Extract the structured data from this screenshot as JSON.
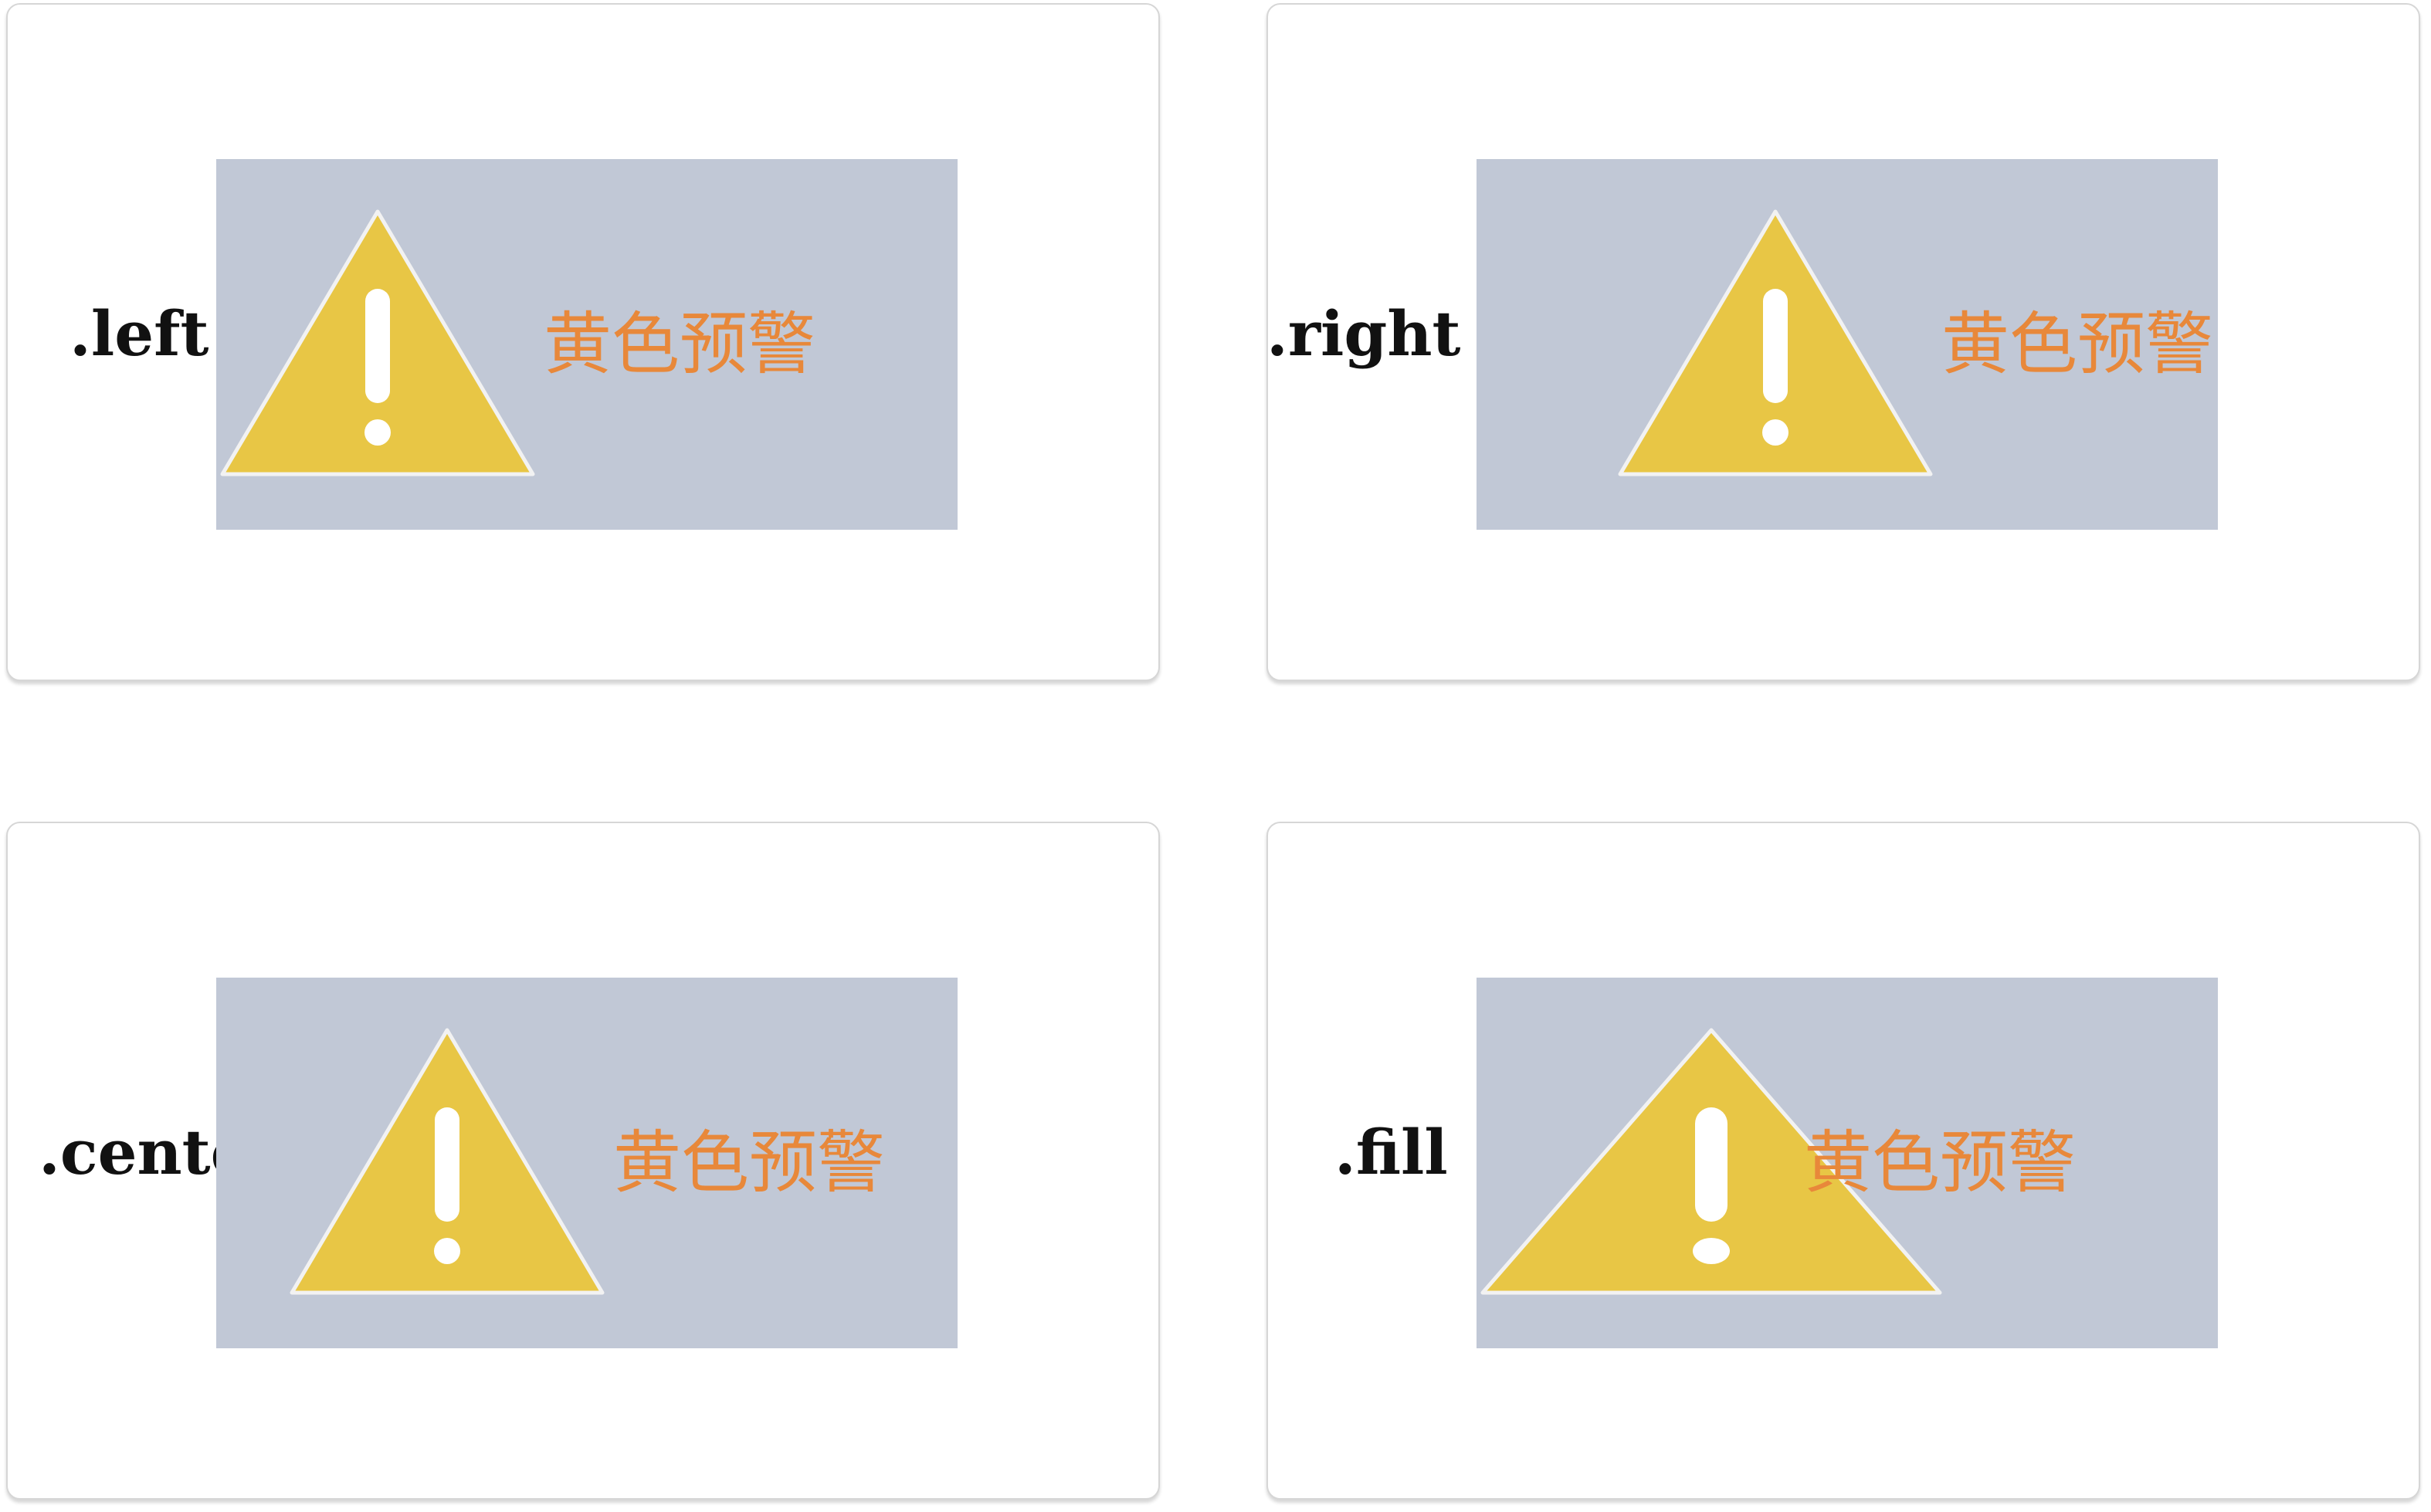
{
  "cards": [
    {
      "id": "left",
      "label": ".left",
      "warning_text": "黄色预警"
    },
    {
      "id": "right",
      "label": ".right",
      "warning_text": "黄色预警"
    },
    {
      "id": "center",
      "label": ".center",
      "warning_text": "黄色预警"
    },
    {
      "id": "fill",
      "label": ".fill",
      "warning_text": "黄色预警"
    }
  ],
  "icon": "warning-triangle-icon",
  "colors": {
    "box_background": "#c1c8d6",
    "triangle_fill": "#e8c645",
    "triangle_stroke": "#f2f2f2",
    "exclamation": "#ffffff",
    "warning_text": "#e8883a"
  }
}
